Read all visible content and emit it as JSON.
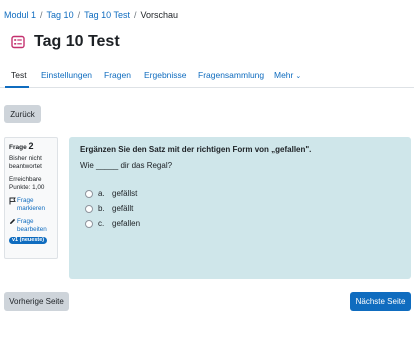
{
  "breadcrumb": {
    "items": [
      "Modul 1",
      "Tag 10",
      "Tag 10 Test"
    ],
    "current": "Vorschau"
  },
  "page": {
    "title": "Tag 10 Test",
    "icon": "quiz-icon",
    "icon_color": "#c4306e"
  },
  "tabs": [
    "Test",
    "Einstellungen",
    "Fragen",
    "Ergebnisse",
    "Fragensammlung",
    "Mehr"
  ],
  "back_button": "Zurück",
  "question_info": {
    "label": "Frage",
    "number": "2",
    "state": "Bisher nicht beantwortet",
    "grade": "Erreichbare Punkte: 1,00",
    "flag": "Frage markieren",
    "edit": "Frage bearbeiten",
    "version": "v1 (neueste)"
  },
  "question": {
    "instruction": "Ergänzen Sie den Satz mit der richtigen Form von „gefallen\".",
    "sentence": "Wie _____ dir das Regal?",
    "answers": [
      {
        "letter": "a.",
        "text": "gefällst"
      },
      {
        "letter": "b.",
        "text": "gefällt"
      },
      {
        "letter": "c.",
        "text": "gefallen"
      }
    ]
  },
  "nav": {
    "prev": "Vorherige Seite",
    "next": "Nächste Seite"
  },
  "colors": {
    "primary": "#0f6cbf",
    "question_bg": "#cfe6ea",
    "secondary_btn": "#ced4da"
  }
}
